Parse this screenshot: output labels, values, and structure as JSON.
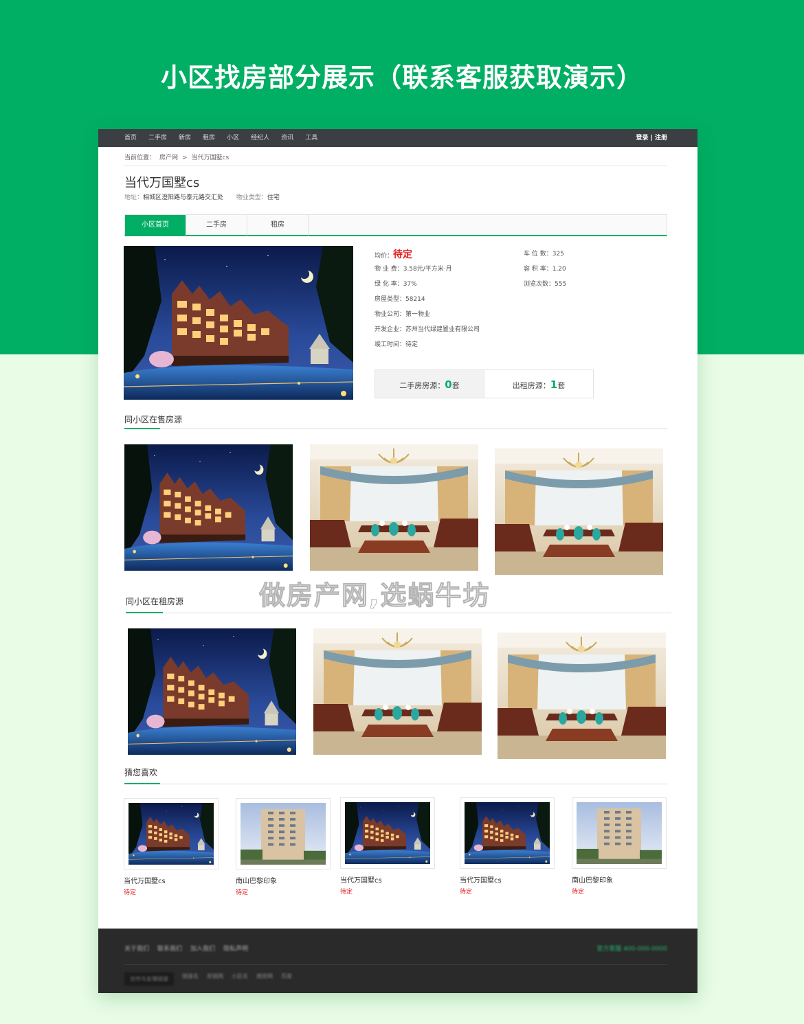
{
  "banner": {
    "title": "小区找房部分展示（联系客服获取演示）"
  },
  "nav": {
    "items": [
      "首页",
      "二手房",
      "新房",
      "租房",
      "小区",
      "经纪人",
      "资讯",
      "工具"
    ],
    "login": "登录 | 注册"
  },
  "breadcrumb": {
    "label": "当前位置：",
    "home": "房产网",
    "sep": ">",
    "current": "当代万国墅cs"
  },
  "community": {
    "name": "当代万国墅cs",
    "address_label": "地址：",
    "address": "相城区澄阳路与泰元路交汇处",
    "type_label": "物业类型：",
    "type": "住宅"
  },
  "tabs": [
    "小区首页",
    "二手房",
    "租房"
  ],
  "details": {
    "price_label": "均价：",
    "price": "待定",
    "fee": "物 业 费：3.58元/平方米·月",
    "green": "绿 化 率：37%",
    "house_type": "房屋类型：58214",
    "company": "物业公司：第一物业",
    "developer": "开发企业：苏州当代绿建置业有限公司",
    "completion": "竣工时间：待定",
    "parking": "车 位 数：325",
    "plot_ratio": "容 积 率：1.20",
    "views": "浏览次数：555"
  },
  "counts": {
    "sale_label": "二手房房源：",
    "sale_count": "0",
    "sale_unit": "套",
    "rent_label": "出租房源：",
    "rent_count": "1",
    "rent_unit": "套"
  },
  "sections": {
    "sale": "同小区在售房源",
    "rent": "同小区在租房源",
    "like": "猜您喜欢"
  },
  "watermark": "做房产网,选蜗牛坊",
  "recommend": [
    {
      "name": "当代万国墅cs",
      "status": "待定"
    },
    {
      "name": "南山巴黎印象",
      "status": "待定"
    },
    {
      "name": "当代万国墅cs",
      "status": "待定"
    },
    {
      "name": "当代万国墅cs",
      "status": "待定"
    },
    {
      "name": "南山巴黎印象",
      "status": "待定"
    }
  ],
  "footer": {
    "links": [
      "关于我们",
      "联系我们",
      "加入我们",
      "隐私声明"
    ],
    "phone": "官方客服 400-000-0000",
    "links2": [
      "合作与友情链接",
      "链接名",
      "房链网",
      "小区名",
      "搜房网",
      "百度"
    ]
  }
}
